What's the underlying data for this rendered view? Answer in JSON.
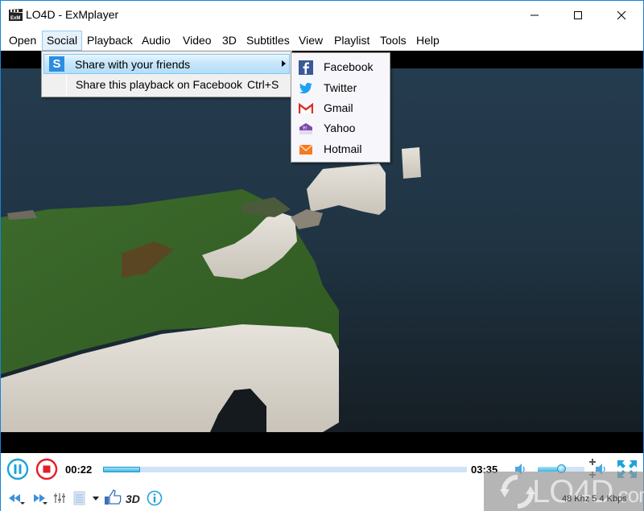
{
  "window": {
    "title": "LO4D - ExMplayer",
    "controls": {
      "minimize": "—",
      "maximize": "☐",
      "close": "✕"
    }
  },
  "menubar": {
    "items": [
      {
        "label": "Open"
      },
      {
        "label": "Social",
        "active": true
      },
      {
        "label": "Playback"
      },
      {
        "label": "Audio"
      },
      {
        "label": "Video"
      },
      {
        "label": "3D"
      },
      {
        "label": "Subtitles"
      },
      {
        "label": "View"
      },
      {
        "label": "Playlist"
      },
      {
        "label": "Tools"
      },
      {
        "label": "Help"
      }
    ]
  },
  "social_menu": {
    "items": [
      {
        "label": "Share with your friends",
        "icon": "S",
        "has_submenu": true,
        "highlighted": true
      },
      {
        "label": "Share this playback on Facebook",
        "shortcut": "Ctrl+S"
      }
    ]
  },
  "share_submenu": {
    "items": [
      {
        "label": "Facebook",
        "icon": "facebook-icon",
        "color": "#3b5998"
      },
      {
        "label": "Twitter",
        "icon": "twitter-icon",
        "color": "#1da1f2"
      },
      {
        "label": "Gmail",
        "icon": "gmail-icon",
        "color": "#d93025"
      },
      {
        "label": "Yahoo",
        "icon": "yahoo-icon",
        "color": "#6e3fa3"
      },
      {
        "label": "Hotmail",
        "icon": "hotmail-icon",
        "color": "#f47b20"
      }
    ]
  },
  "playback": {
    "elapsed": "00:22",
    "duration": "03:35",
    "progress_fraction": 0.102,
    "volume_fraction": 0.5
  },
  "toolbar": {
    "three_d_label": "3D"
  },
  "status": {
    "audio_info": "48 Khz 5 4 Kbps"
  },
  "watermark": {
    "text": "LO4D",
    "suffix": ".com"
  },
  "colors": {
    "accent": "#1883d7",
    "play_blue": "#1ca3dc",
    "stop_red": "#e41e26"
  }
}
